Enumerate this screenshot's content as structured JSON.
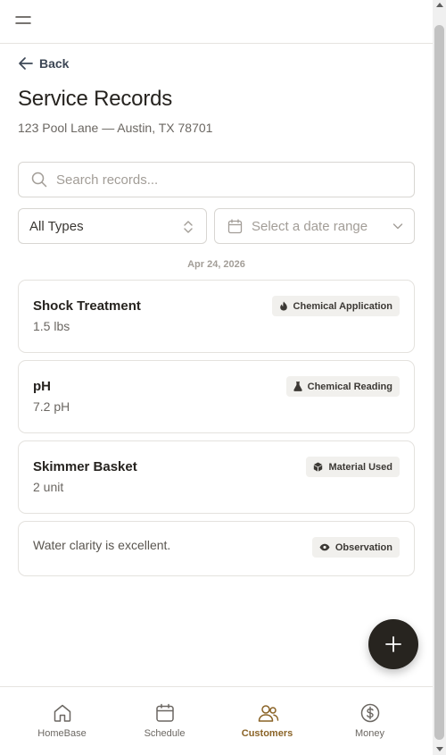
{
  "header": {
    "menu_icon": "hamburger-menu-icon"
  },
  "back": {
    "label": "Back",
    "icon": "arrow-left-icon"
  },
  "page": {
    "title": "Service Records",
    "address": "123 Pool Lane — Austin, TX 78701"
  },
  "search": {
    "placeholder": "Search records...",
    "value": "",
    "icon": "search-icon"
  },
  "filters": {
    "type": {
      "selected": "All Types",
      "icon": "chevron-up-down-icon"
    },
    "date": {
      "placeholder": "Select a date range",
      "icon": "calendar-icon",
      "chevron": "chevron-down-icon"
    }
  },
  "records": {
    "date_group": "Apr 24, 2026",
    "items": [
      {
        "name": "Shock Treatment",
        "value": "1.5 lbs",
        "badge": "Chemical Application",
        "badge_icon": "flame-icon"
      },
      {
        "name": "pH",
        "value": "7.2 pH",
        "badge": "Chemical Reading",
        "badge_icon": "flask-icon"
      },
      {
        "name": "Skimmer Basket",
        "value": "2 unit",
        "badge": "Material Used",
        "badge_icon": "box-icon"
      },
      {
        "note": "Water clarity is excellent.",
        "badge": "Observation",
        "badge_icon": "eye-icon"
      }
    ]
  },
  "fab": {
    "icon": "plus-icon"
  },
  "nav": {
    "active": "Customers",
    "active_color": "#8a6326",
    "items": [
      {
        "label": "HomeBase",
        "icon": "home-icon"
      },
      {
        "label": "Schedule",
        "icon": "calendar-icon"
      },
      {
        "label": "Customers",
        "icon": "users-icon"
      },
      {
        "label": "Money",
        "icon": "dollar-circle-icon"
      }
    ]
  },
  "colors": {
    "text": "#26231f",
    "muted": "#6b6762",
    "fab": "#27241f",
    "border": "#e4e2de"
  }
}
